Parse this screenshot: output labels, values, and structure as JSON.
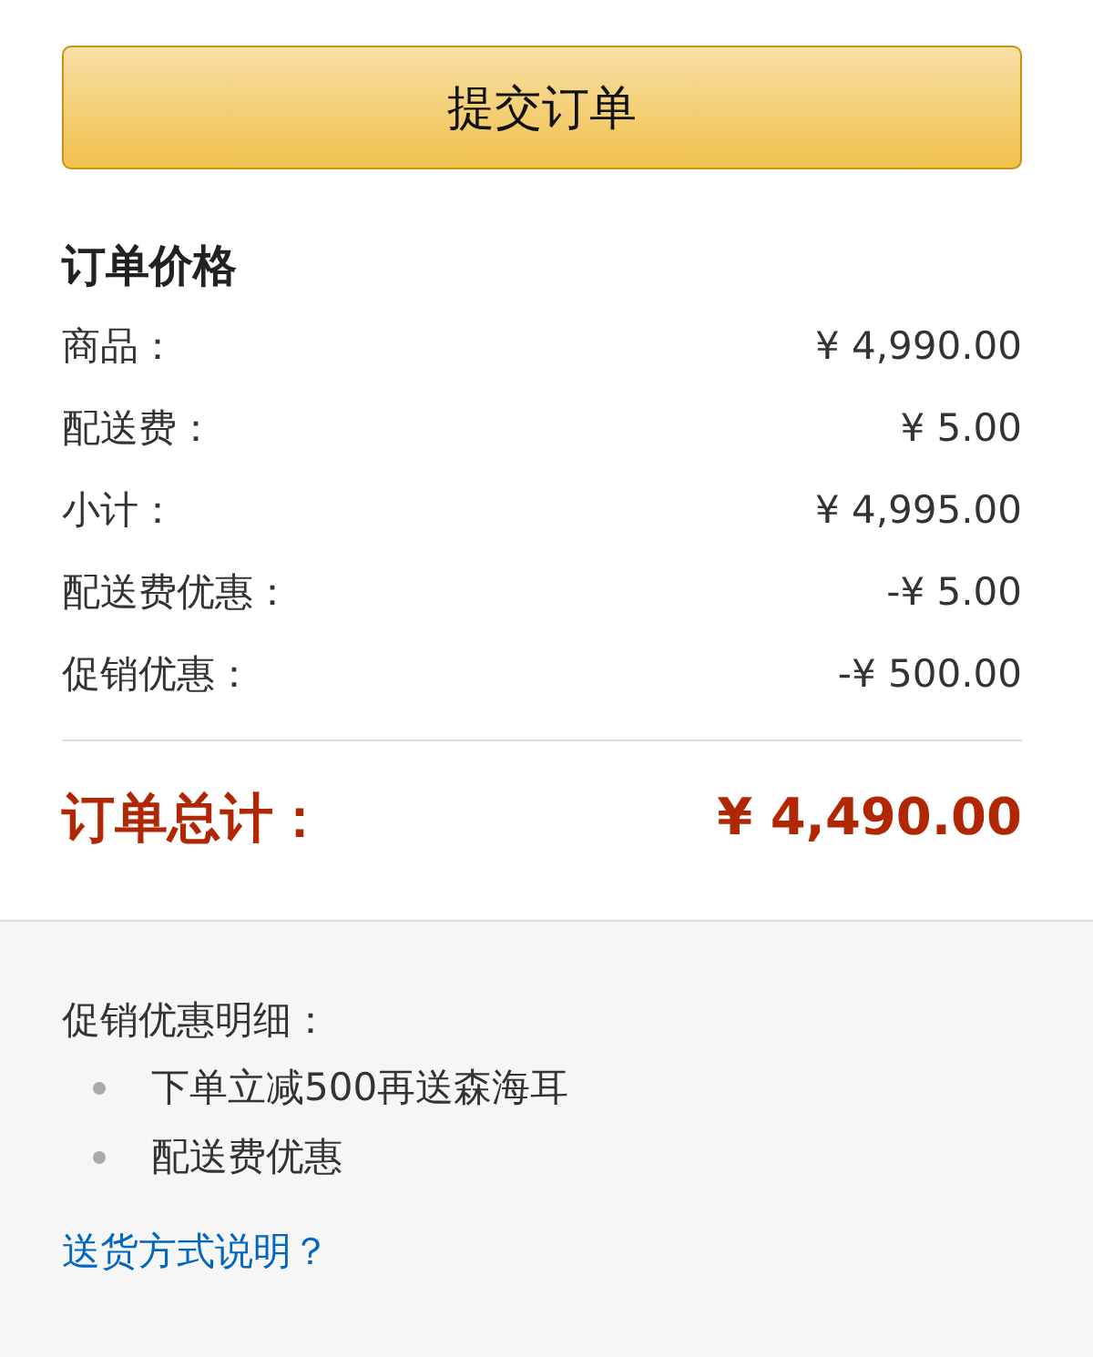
{
  "submit_button": {
    "label": "提交订单"
  },
  "price_summary": {
    "title": "订单价格",
    "rows": [
      {
        "label": "商品：",
        "value": "¥ 4,990.00"
      },
      {
        "label": "配送费：",
        "value": "¥ 5.00"
      },
      {
        "label": "小计：",
        "value": "¥ 4,995.00"
      },
      {
        "label": "配送费优惠：",
        "value": "-¥ 5.00"
      },
      {
        "label": "促销优惠：",
        "value": "-¥ 500.00"
      }
    ],
    "total": {
      "label": "订单总计：",
      "value": "¥ 4,490.00"
    }
  },
  "promotion_details": {
    "title": "促销优惠明细：",
    "items": [
      "下单立减500再送森海耳",
      "配送费优惠"
    ]
  },
  "delivery_link": {
    "label": "送货方式说明？"
  }
}
